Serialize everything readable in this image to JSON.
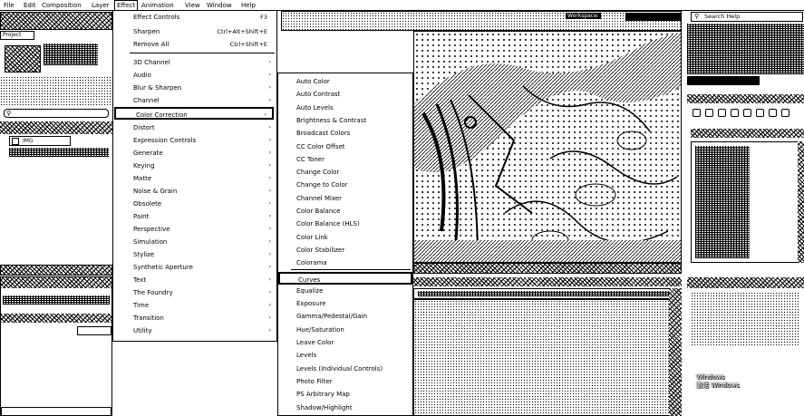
{
  "menubar": {
    "items": [
      "File",
      "Edit",
      "Composition",
      "Layer",
      "Effect",
      "Animation",
      "View",
      "Window",
      "Help"
    ]
  },
  "workspace_label": "Workspace:",
  "search_help": {
    "placeholder": "Search Help"
  },
  "left_panel": {
    "project_tab": "Project",
    "layer_name": "IMG"
  },
  "effect_menu": {
    "items": [
      {
        "label": "Effect Controls",
        "shortcut": "F3"
      },
      {
        "label": "Sharpen",
        "shortcut": "Ctrl+Alt+Shift+E"
      },
      {
        "label": "Remove All",
        "shortcut": "Ctrl+Shift+E"
      },
      {
        "label": "3D Channel"
      },
      {
        "label": "Audio"
      },
      {
        "label": "Blur & Sharpen"
      },
      {
        "label": "Channel"
      },
      {
        "label": "Color Correction"
      },
      {
        "label": "Distort"
      },
      {
        "label": "Expression Controls"
      },
      {
        "label": "Generate"
      },
      {
        "label": "Keying"
      },
      {
        "label": "Matte"
      },
      {
        "label": "Noise & Grain"
      },
      {
        "label": "Obsolete"
      },
      {
        "label": "Paint"
      },
      {
        "label": "Perspective"
      },
      {
        "label": "Simulation"
      },
      {
        "label": "Stylize"
      },
      {
        "label": "Synthetic Aperture"
      },
      {
        "label": "Text"
      },
      {
        "label": "The Foundry"
      },
      {
        "label": "Time"
      },
      {
        "label": "Transition"
      },
      {
        "label": "Utility"
      }
    ],
    "highlighted": "Color Correction"
  },
  "color_correction_menu": {
    "items": [
      "Auto Color",
      "Auto Contrast",
      "Auto Levels",
      "Brightness & Contrast",
      "Broadcast Colors",
      "CC Color Offset",
      "CC Toner",
      "Change Color",
      "Change to Color",
      "Channel Mixer",
      "Color Balance",
      "Color Balance (HLS)",
      "Color Link",
      "Color Stabilizer",
      "Colorama",
      "Curves",
      "Equalize",
      "Exposure",
      "Gamma/Pedestal/Gain",
      "Hue/Saturation",
      "Leave Color",
      "Levels",
      "Levels (Individual Controls)",
      "Photo Filter",
      "PS Arbitrary Map",
      "Shadow/Highlight"
    ],
    "highlighted": "Curves"
  },
  "watermark": {
    "line1": "Windows",
    "line2": "激活 Windows"
  }
}
